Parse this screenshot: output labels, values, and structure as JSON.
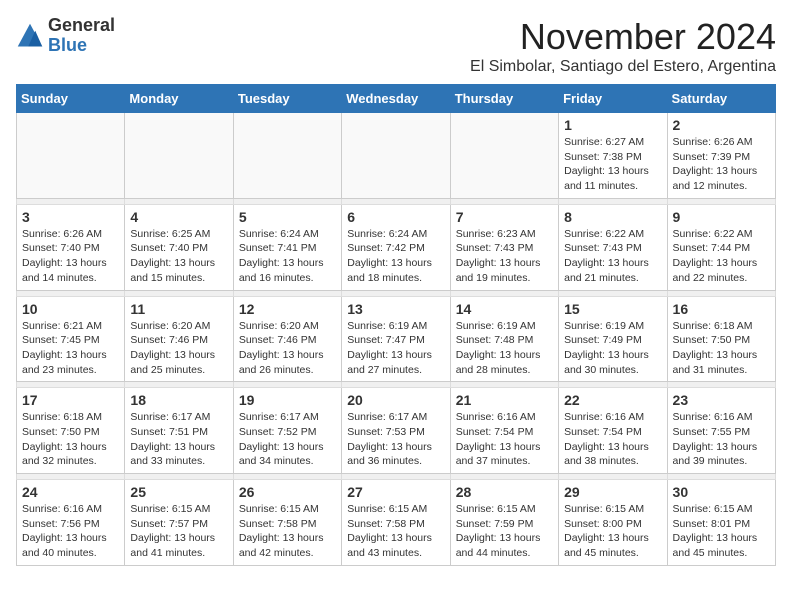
{
  "logo": {
    "general": "General",
    "blue": "Blue"
  },
  "header": {
    "month": "November 2024",
    "location": "El Simbolar, Santiago del Estero, Argentina"
  },
  "weekdays": [
    "Sunday",
    "Monday",
    "Tuesday",
    "Wednesday",
    "Thursday",
    "Friday",
    "Saturday"
  ],
  "weeks": [
    [
      {
        "day": "",
        "info": ""
      },
      {
        "day": "",
        "info": ""
      },
      {
        "day": "",
        "info": ""
      },
      {
        "day": "",
        "info": ""
      },
      {
        "day": "",
        "info": ""
      },
      {
        "day": "1",
        "info": "Sunrise: 6:27 AM\nSunset: 7:38 PM\nDaylight: 13 hours and 11 minutes."
      },
      {
        "day": "2",
        "info": "Sunrise: 6:26 AM\nSunset: 7:39 PM\nDaylight: 13 hours and 12 minutes."
      }
    ],
    [
      {
        "day": "3",
        "info": "Sunrise: 6:26 AM\nSunset: 7:40 PM\nDaylight: 13 hours and 14 minutes."
      },
      {
        "day": "4",
        "info": "Sunrise: 6:25 AM\nSunset: 7:40 PM\nDaylight: 13 hours and 15 minutes."
      },
      {
        "day": "5",
        "info": "Sunrise: 6:24 AM\nSunset: 7:41 PM\nDaylight: 13 hours and 16 minutes."
      },
      {
        "day": "6",
        "info": "Sunrise: 6:24 AM\nSunset: 7:42 PM\nDaylight: 13 hours and 18 minutes."
      },
      {
        "day": "7",
        "info": "Sunrise: 6:23 AM\nSunset: 7:43 PM\nDaylight: 13 hours and 19 minutes."
      },
      {
        "day": "8",
        "info": "Sunrise: 6:22 AM\nSunset: 7:43 PM\nDaylight: 13 hours and 21 minutes."
      },
      {
        "day": "9",
        "info": "Sunrise: 6:22 AM\nSunset: 7:44 PM\nDaylight: 13 hours and 22 minutes."
      }
    ],
    [
      {
        "day": "10",
        "info": "Sunrise: 6:21 AM\nSunset: 7:45 PM\nDaylight: 13 hours and 23 minutes."
      },
      {
        "day": "11",
        "info": "Sunrise: 6:20 AM\nSunset: 7:46 PM\nDaylight: 13 hours and 25 minutes."
      },
      {
        "day": "12",
        "info": "Sunrise: 6:20 AM\nSunset: 7:46 PM\nDaylight: 13 hours and 26 minutes."
      },
      {
        "day": "13",
        "info": "Sunrise: 6:19 AM\nSunset: 7:47 PM\nDaylight: 13 hours and 27 minutes."
      },
      {
        "day": "14",
        "info": "Sunrise: 6:19 AM\nSunset: 7:48 PM\nDaylight: 13 hours and 28 minutes."
      },
      {
        "day": "15",
        "info": "Sunrise: 6:19 AM\nSunset: 7:49 PM\nDaylight: 13 hours and 30 minutes."
      },
      {
        "day": "16",
        "info": "Sunrise: 6:18 AM\nSunset: 7:50 PM\nDaylight: 13 hours and 31 minutes."
      }
    ],
    [
      {
        "day": "17",
        "info": "Sunrise: 6:18 AM\nSunset: 7:50 PM\nDaylight: 13 hours and 32 minutes."
      },
      {
        "day": "18",
        "info": "Sunrise: 6:17 AM\nSunset: 7:51 PM\nDaylight: 13 hours and 33 minutes."
      },
      {
        "day": "19",
        "info": "Sunrise: 6:17 AM\nSunset: 7:52 PM\nDaylight: 13 hours and 34 minutes."
      },
      {
        "day": "20",
        "info": "Sunrise: 6:17 AM\nSunset: 7:53 PM\nDaylight: 13 hours and 36 minutes."
      },
      {
        "day": "21",
        "info": "Sunrise: 6:16 AM\nSunset: 7:54 PM\nDaylight: 13 hours and 37 minutes."
      },
      {
        "day": "22",
        "info": "Sunrise: 6:16 AM\nSunset: 7:54 PM\nDaylight: 13 hours and 38 minutes."
      },
      {
        "day": "23",
        "info": "Sunrise: 6:16 AM\nSunset: 7:55 PM\nDaylight: 13 hours and 39 minutes."
      }
    ],
    [
      {
        "day": "24",
        "info": "Sunrise: 6:16 AM\nSunset: 7:56 PM\nDaylight: 13 hours and 40 minutes."
      },
      {
        "day": "25",
        "info": "Sunrise: 6:15 AM\nSunset: 7:57 PM\nDaylight: 13 hours and 41 minutes."
      },
      {
        "day": "26",
        "info": "Sunrise: 6:15 AM\nSunset: 7:58 PM\nDaylight: 13 hours and 42 minutes."
      },
      {
        "day": "27",
        "info": "Sunrise: 6:15 AM\nSunset: 7:58 PM\nDaylight: 13 hours and 43 minutes."
      },
      {
        "day": "28",
        "info": "Sunrise: 6:15 AM\nSunset: 7:59 PM\nDaylight: 13 hours and 44 minutes."
      },
      {
        "day": "29",
        "info": "Sunrise: 6:15 AM\nSunset: 8:00 PM\nDaylight: 13 hours and 45 minutes."
      },
      {
        "day": "30",
        "info": "Sunrise: 6:15 AM\nSunset: 8:01 PM\nDaylight: 13 hours and 45 minutes."
      }
    ]
  ]
}
